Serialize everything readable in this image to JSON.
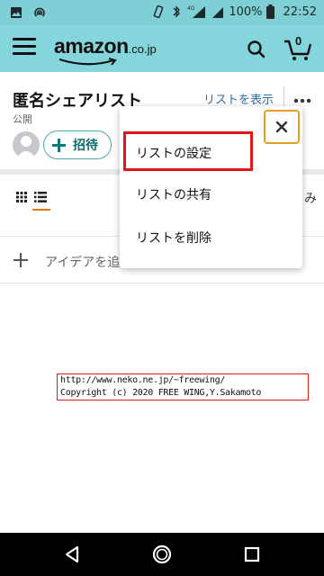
{
  "status_bar": {
    "battery_percent": "100%",
    "time": "22:52",
    "network_label": "4G"
  },
  "app_header": {
    "logo_main": "amazon",
    "logo_sub": ".co.jp",
    "cart_count": "0"
  },
  "list": {
    "title": "匿名シェアリスト",
    "view_list_link": "リストを表示",
    "privacy": "公開",
    "invite_label": "招待",
    "add_idea_label": "アイデアを追"
  },
  "filter_peek": "み",
  "popup_menu": {
    "items": [
      {
        "label": "リストの設定"
      },
      {
        "label": "リストの共有"
      },
      {
        "label": "リストを削除"
      }
    ],
    "close_label": "×"
  },
  "watermark": {
    "line1": "http://www.neko.ne.jp/~freewing/",
    "line2": "Copyright (c) 2020 FREE WING,Y.Sakamoto"
  },
  "colors": {
    "header_bg": "#84d6dc",
    "status_bg": "#7ed0d6",
    "link": "#2d6fa3",
    "accent_orange": "#e47911",
    "highlight_red": "#e0161a",
    "invite_teal": "#0f6d6d"
  }
}
